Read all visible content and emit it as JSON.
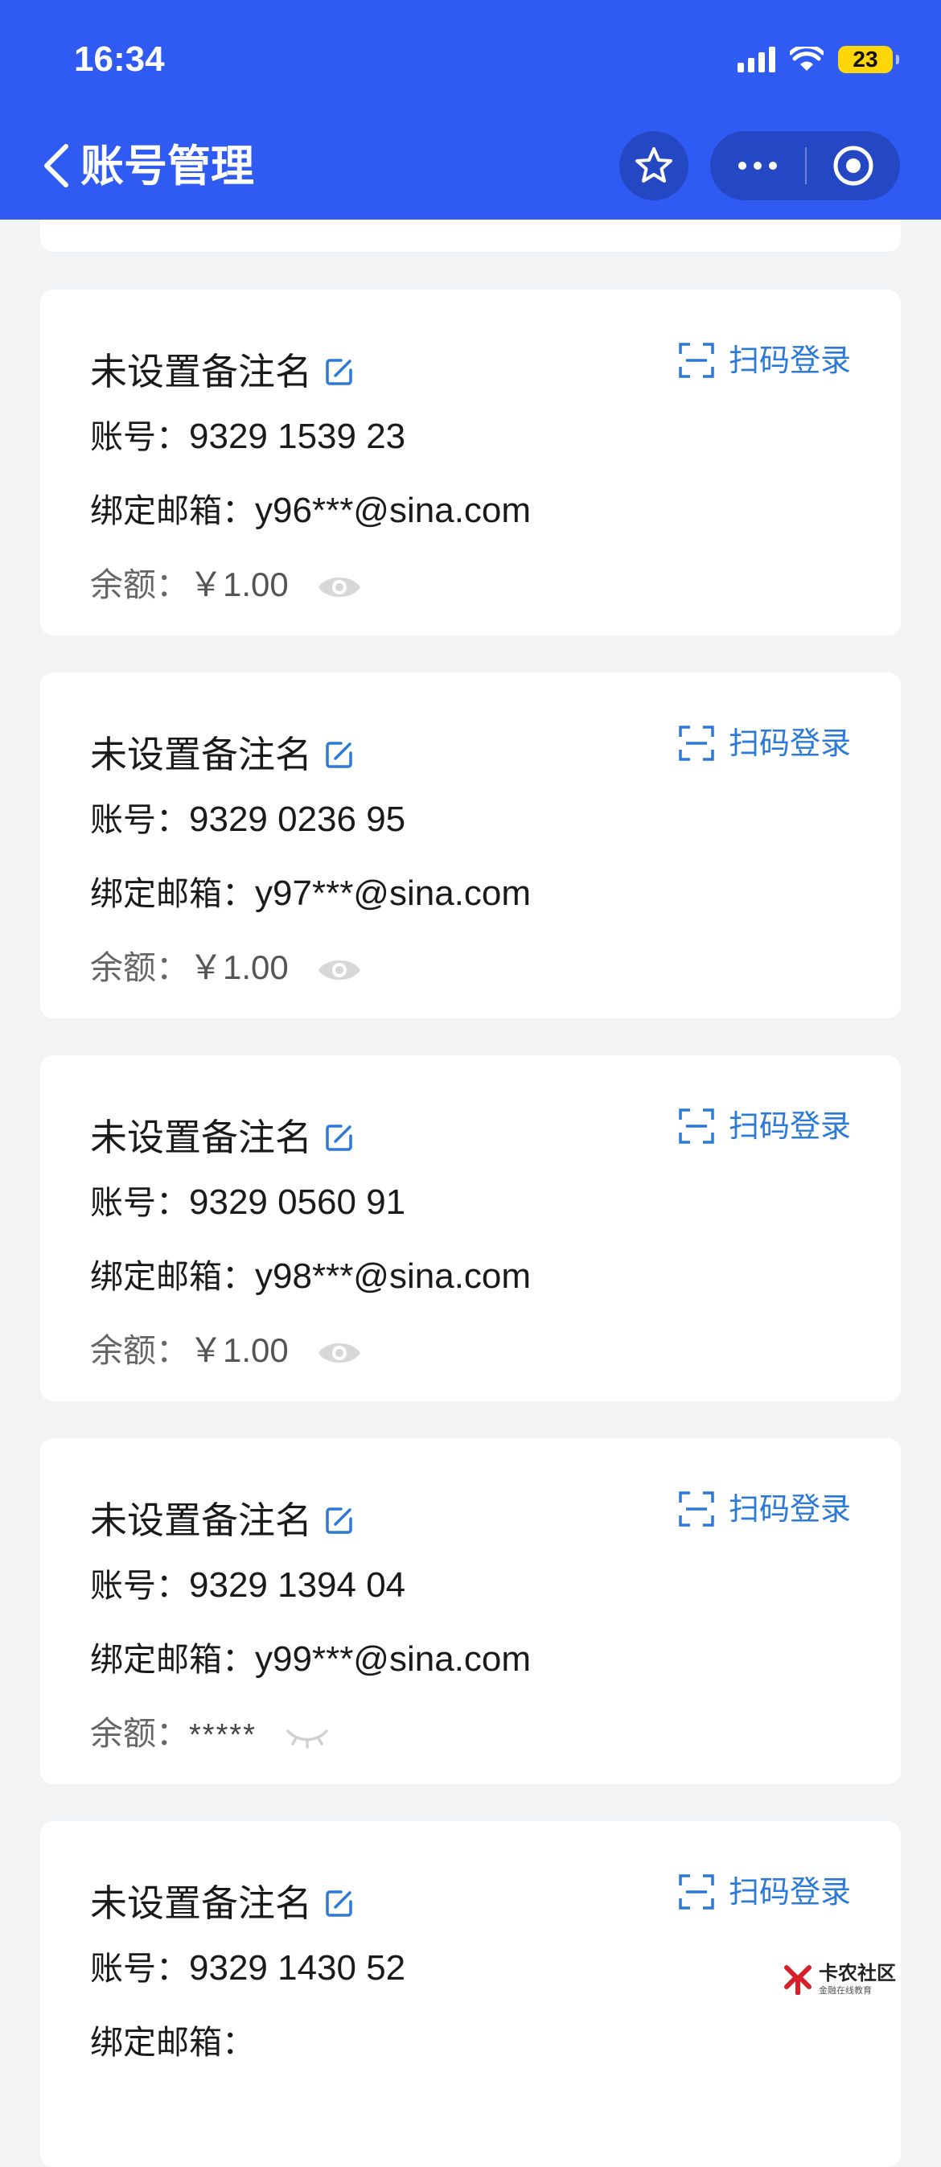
{
  "status_bar": {
    "time": "16:34",
    "battery": "23"
  },
  "nav": {
    "title": "账号管理"
  },
  "labels": {
    "account_prefix": "账号：",
    "email_prefix": "绑定邮箱：",
    "balance_prefix": "余额：",
    "scan_login": "扫码登录",
    "no_remark": "未设置备注名"
  },
  "accounts": [
    {
      "remark": "未设置备注名",
      "account": "9329 1539 23",
      "email": "y96***@sina.com",
      "balance": "￥1.00",
      "balance_visible": true
    },
    {
      "remark": "未设置备注名",
      "account": "9329 0236 95",
      "email": "y97***@sina.com",
      "balance": "￥1.00",
      "balance_visible": true
    },
    {
      "remark": "未设置备注名",
      "account": "9329 0560 91",
      "email": "y98***@sina.com",
      "balance": "￥1.00",
      "balance_visible": true
    },
    {
      "remark": "未设置备注名",
      "account": "9329 1394 04",
      "email": "y99***@sina.com",
      "balance": "*****",
      "balance_visible": false
    },
    {
      "remark": "未设置备注名",
      "account": "9329 1430 52",
      "email": "",
      "balance": "",
      "balance_visible": true
    }
  ],
  "watermark": {
    "main": "卡农社区",
    "sub": "金融在线教育"
  },
  "colors": {
    "header": "#2f5bf2",
    "accent_link": "#2b7ad9",
    "background": "#f2f3f5"
  },
  "icons": [
    "back-chevron-icon",
    "star-icon",
    "more-dots-icon",
    "target-icon",
    "edit-icon",
    "scan-icon",
    "eye-icon",
    "eye-closed-icon"
  ]
}
